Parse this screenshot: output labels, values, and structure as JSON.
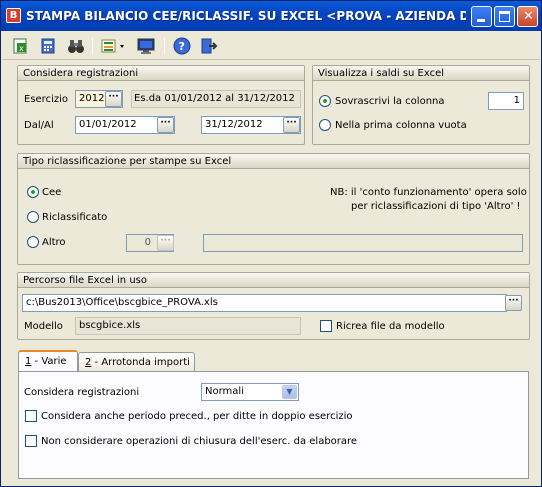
{
  "window": {
    "title": "STAMPA BILANCIO CEE/RICLASSIF. SU EXCEL <PROVA - AZIENDA DI PR..."
  },
  "registrazioni": {
    "header": "Considera registrazioni",
    "esercizio_label": "Esercizio",
    "esercizio_value": "2012",
    "esercizio_desc": "Es.da 01/01/2012 al 31/12/2012",
    "dalal_label": "Dal/Al",
    "dal_value": "01/01/2012",
    "al_value": "31/12/2012"
  },
  "visualizza": {
    "header": "Visualizza i saldi su Excel",
    "opt_sovrascrivi": "Sovrascrivi la colonna",
    "colonna_value": "1",
    "opt_prima": "Nella prima colonna vuota"
  },
  "tipo": {
    "header": "Tipo riclassificazione per stampe su Excel",
    "opt_cee": "Cee",
    "opt_riclass": "Riclassificato",
    "opt_altro": "Altro",
    "altro_value": "0",
    "nb_line1": "NB: il 'conto funzionamento' opera solo",
    "nb_line2": "per riclassificazioni di tipo 'Altro' !"
  },
  "percorso": {
    "header": "Percorso file Excel in uso",
    "path_value": "c:\\Bus2013\\Office\\bscgbice_PROVA.xls",
    "modello_label": "Modello",
    "modello_value": "bscgbice.xls",
    "ricrea_label": "Ricrea file da modello"
  },
  "tabs": [
    {
      "num": "1",
      "label": " - Varie"
    },
    {
      "num": "2",
      "label": " - Arrotonda importi"
    }
  ],
  "varie": {
    "considera_label": "Considera registrazioni",
    "considera_value": "Normali",
    "chk_periodo": "Considera anche periodo preced., per ditte in doppio esercizio",
    "chk_chiusura": "Non considerare operazioni di chiusura dell'eserc. da elaborare"
  }
}
